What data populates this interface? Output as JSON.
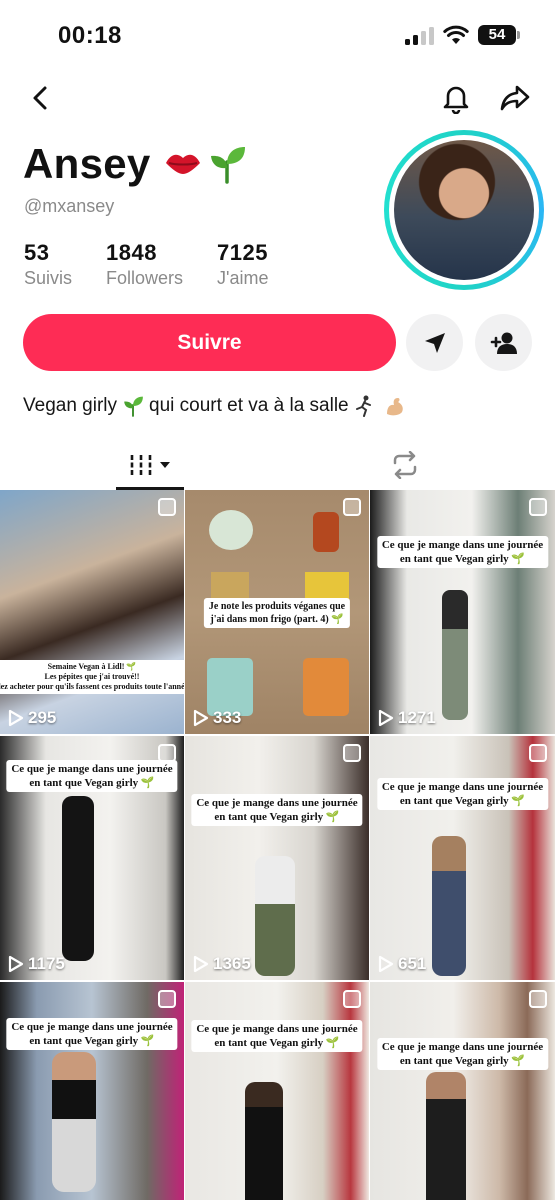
{
  "status_bar": {
    "time": "00:18",
    "battery": "54"
  },
  "profile": {
    "display_name": "Ansey",
    "username": "@mxansey",
    "stats": [
      {
        "value": "53",
        "label": "Suivis"
      },
      {
        "value": "1848",
        "label": "Followers"
      },
      {
        "value": "7125",
        "label": "J'aime"
      }
    ],
    "follow_label": "Suivre",
    "bio_part1": "Vegan girly",
    "bio_part2": "qui court et va à la salle",
    "accent_color": "#fe2c55",
    "ring_color": "#1fd3c6"
  },
  "icons": {
    "nav": [
      "back-icon",
      "bell-icon",
      "share-icon"
    ],
    "actions": [
      "send-icon",
      "add-user-icon"
    ],
    "tabs": [
      "videos-grid-icon",
      "repost-icon"
    ]
  },
  "videos": [
    {
      "views": "295",
      "caption": [
        "Semaine Vegan à Lidl! 🌱",
        "Les pépites que j'ai trouvé!!",
        "Allez acheter pour qu'ils fassent ces produits toute l'année!!"
      ]
    },
    {
      "views": "333",
      "caption": [
        "Je note les produits véganes que",
        "j'ai dans mon frigo (part. 4) 🌱"
      ]
    },
    {
      "views": "1271",
      "caption": [
        "Ce que je mange dans une journée",
        "en tant que Vegan girly 🌱"
      ]
    },
    {
      "views": "1175",
      "caption": [
        "Ce que je mange dans une journée",
        "en tant que Vegan girly 🌱"
      ]
    },
    {
      "views": "1365",
      "caption": [
        "Ce que je mange dans une journée",
        "en tant que Vegan girly 🌱"
      ]
    },
    {
      "views": "651",
      "caption": [
        "Ce que je mange dans une journée",
        "en tant que Vegan girly 🌱"
      ]
    },
    {
      "views": "",
      "caption": [
        "Ce que je mange dans une journée",
        "en tant que Vegan girly 🌱"
      ]
    },
    {
      "views": "",
      "caption": [
        "Ce que je mange dans une journée",
        "en tant que Vegan girly 🌱"
      ]
    },
    {
      "views": "",
      "caption": [
        "Ce que je mange dans une journée",
        "en tant que Vegan girly 🌱"
      ]
    }
  ]
}
